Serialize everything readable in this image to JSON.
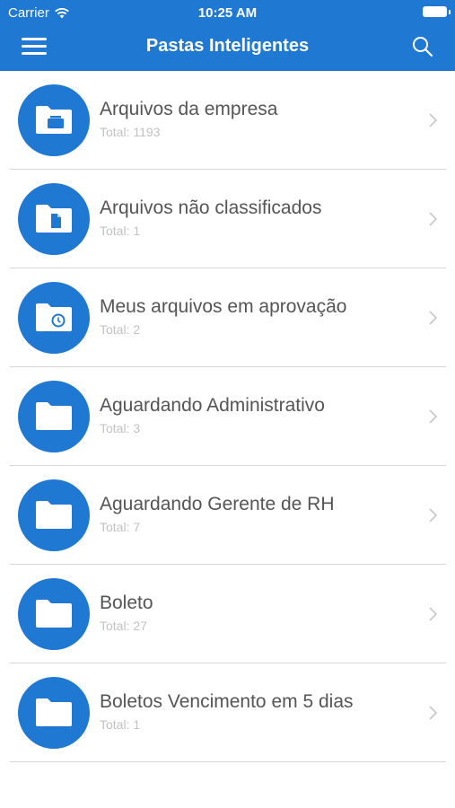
{
  "status_bar": {
    "carrier": "Carrier",
    "time": "10:25 AM"
  },
  "header": {
    "title": "Pastas Inteligentes"
  },
  "colors": {
    "accent": "#1f78d1",
    "divider": "#d6d6d6",
    "label": "#555555",
    "count": "#c2c2c2"
  },
  "folders": [
    {
      "name": "Arquivos da empresa",
      "count": "Total: 1193",
      "icon": "briefcase-folder-icon"
    },
    {
      "name": "Arquivos não classificados",
      "count": "Total: 1",
      "icon": "document-folder-icon"
    },
    {
      "name": "Meus arquivos em aprovação",
      "count": "Total: 2",
      "icon": "clock-folder-icon"
    },
    {
      "name": "Aguardando Administrativo",
      "count": "Total: 3",
      "icon": "folder-icon"
    },
    {
      "name": "Aguardando Gerente de RH",
      "count": "Total: 7",
      "icon": "folder-icon"
    },
    {
      "name": "Boleto",
      "count": "Total: 27",
      "icon": "folder-icon"
    },
    {
      "name": "Boletos Vencimento em 5 dias",
      "count": "Total: 1",
      "icon": "folder-icon"
    }
  ]
}
